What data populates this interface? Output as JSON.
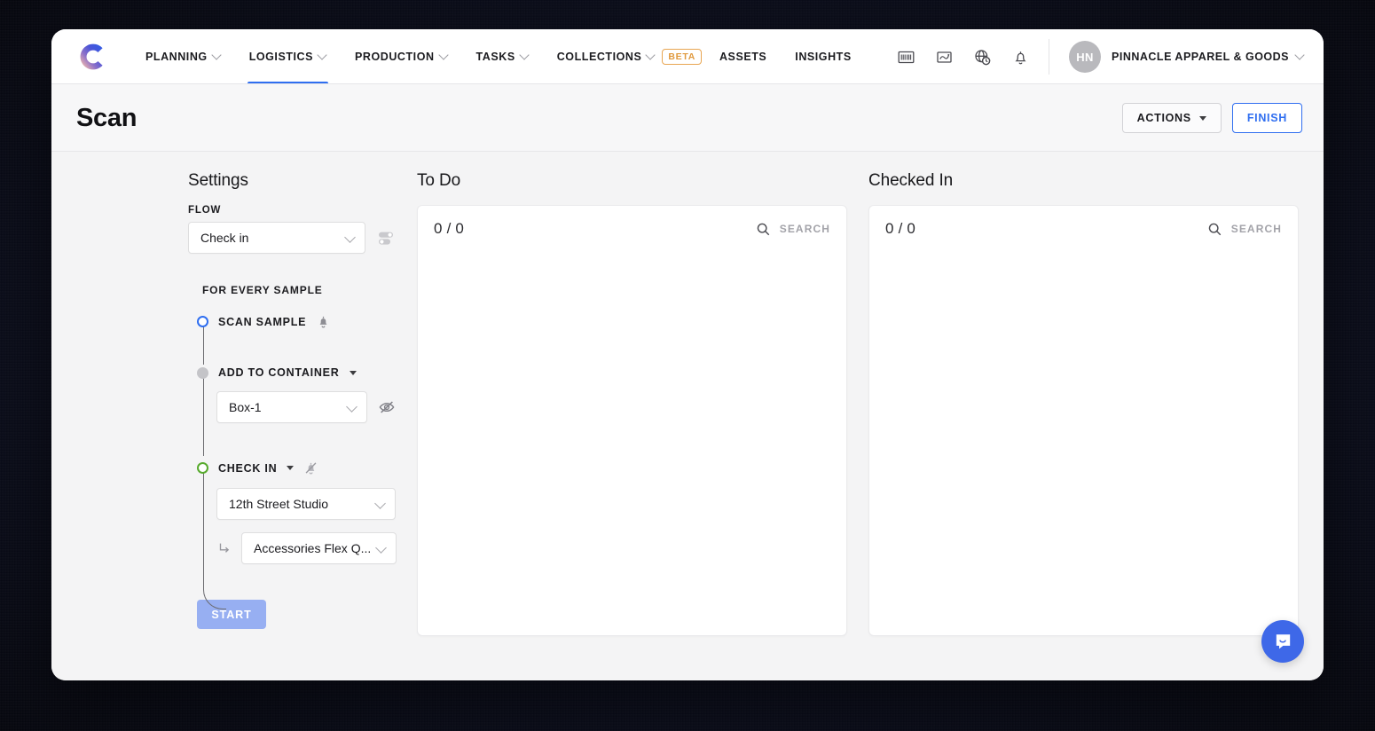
{
  "nav": {
    "logo_icon": "crossbeam-c-logo",
    "items": [
      {
        "label": "PLANNING",
        "has_caret": true,
        "active": false
      },
      {
        "label": "LOGISTICS",
        "has_caret": true,
        "active": true
      },
      {
        "label": "PRODUCTION",
        "has_caret": true,
        "active": false
      },
      {
        "label": "TASKS",
        "has_caret": true,
        "active": false
      },
      {
        "label": "COLLECTIONS",
        "has_caret": true,
        "active": false
      },
      {
        "label": "ASSETS",
        "has_caret": false,
        "active": false
      },
      {
        "label": "INSIGHTS",
        "has_caret": false,
        "active": false
      }
    ],
    "beta_badge": "BETA",
    "icons": [
      "barcode-icon",
      "inbox-arrow-icon",
      "globe-clock-icon",
      "bell-icon"
    ],
    "avatar_initials": "HN",
    "org_name": "PINNACLE APPAREL & GOODS"
  },
  "header": {
    "title": "Scan",
    "actions_label": "ACTIONS",
    "finish_label": "FINISH"
  },
  "settings": {
    "title": "Settings",
    "flow_label": "FLOW",
    "flow_value": "Check in",
    "toggles_icon": "toggles-icon",
    "for_every_sample": "FOR EVERY SAMPLE",
    "steps": [
      {
        "label": "SCAN SAMPLE",
        "dot": "blue",
        "icons": [
          "bell-icon"
        ],
        "has_caret": false
      },
      {
        "label": "ADD TO CONTAINER",
        "dot": "filled",
        "icons": [],
        "has_caret": true,
        "field_value": "Box-1",
        "field_icon": "eye-slash-icon"
      },
      {
        "label": "CHECK IN",
        "dot": "green",
        "icons": [
          "bell-off-icon"
        ],
        "has_caret": true,
        "field_value": "12th Street Studio",
        "nested_icon": "arrow-turn-down-right-icon",
        "nested_value": "Accessories Flex Q..."
      }
    ],
    "start_label": "START"
  },
  "panels": [
    {
      "title": "To Do",
      "counter": "0 / 0",
      "search_icon": "search-icon",
      "search_placeholder": "SEARCH"
    },
    {
      "title": "Checked In",
      "counter": "0 / 0",
      "search_icon": "search-icon",
      "search_placeholder": "SEARCH"
    }
  ],
  "chat": {
    "icon": "chat-bubble-icon"
  },
  "colors": {
    "accent_blue": "#2f6ef0",
    "beta_orange": "#e09a3f",
    "step_green": "#57aa2d",
    "start_disabled": "#97aff2",
    "chat_blue": "#3e68e8"
  }
}
